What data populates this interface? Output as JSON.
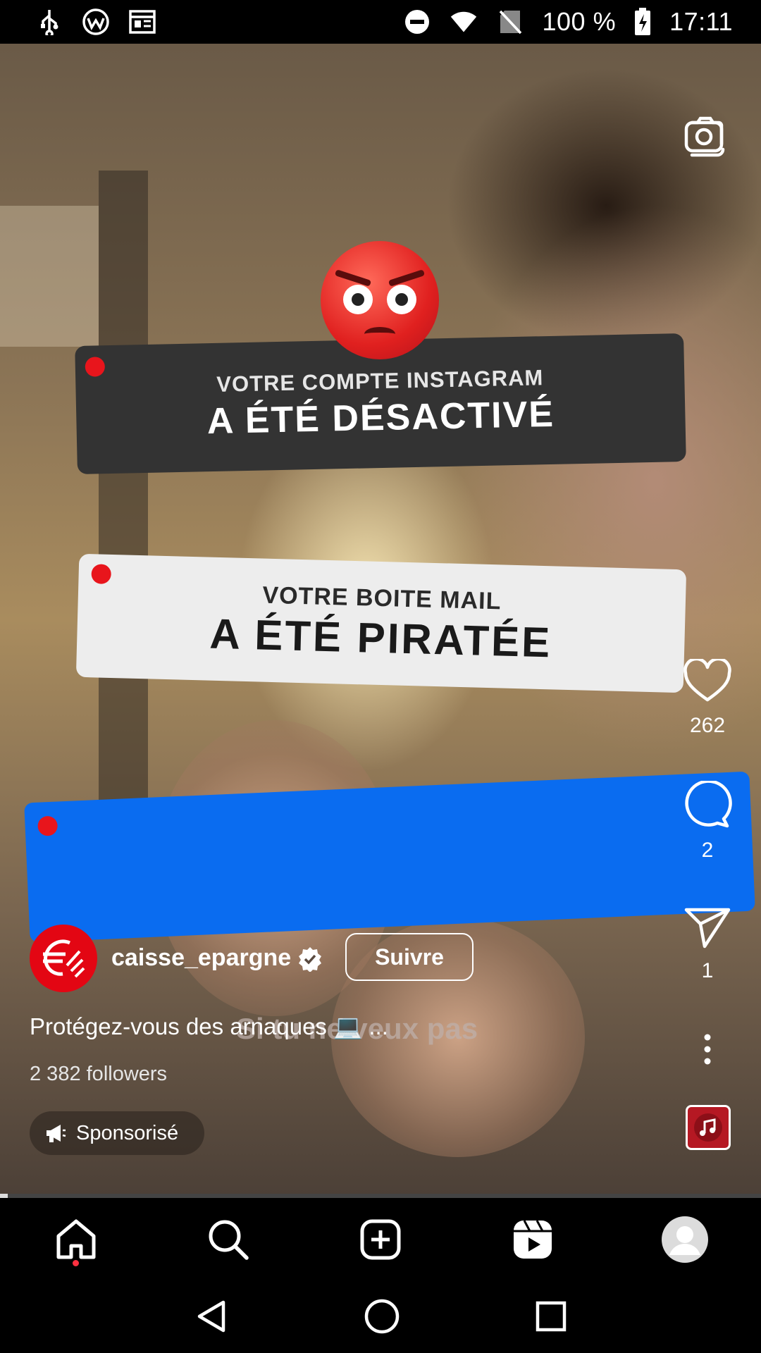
{
  "status_bar": {
    "battery": "100 %",
    "time": "17:11",
    "icons": [
      "usb-icon",
      "vpn-icon",
      "news-icon",
      "dnd-icon",
      "wifi-icon",
      "no-signal-icon",
      "battery-charging-icon"
    ]
  },
  "video": {
    "banner1": {
      "small": "VOTRE COMPTE INSTAGRAM",
      "big": "A ÉTÉ DÉSACTIVÉ"
    },
    "banner2": {
      "small": "VOTRE BOITE MAIL",
      "big": "A ÉTÉ PIRATÉE"
    },
    "subtitle_overlay": "Si tu ne veux pas",
    "progress": 0.01
  },
  "actions": {
    "likes": "262",
    "comments": "2",
    "shares": "1"
  },
  "post": {
    "username": "caisse_epargne",
    "follow_label": "Suivre",
    "caption": "Protégez-vous des arnaques 💻 ...",
    "followers": "2 382 followers",
    "sponsored_label": "Sponsorisé"
  },
  "colors": {
    "brand_red": "#e30613",
    "banner_blue": "#0a6cf0",
    "notification_dot": "#ff3040"
  }
}
